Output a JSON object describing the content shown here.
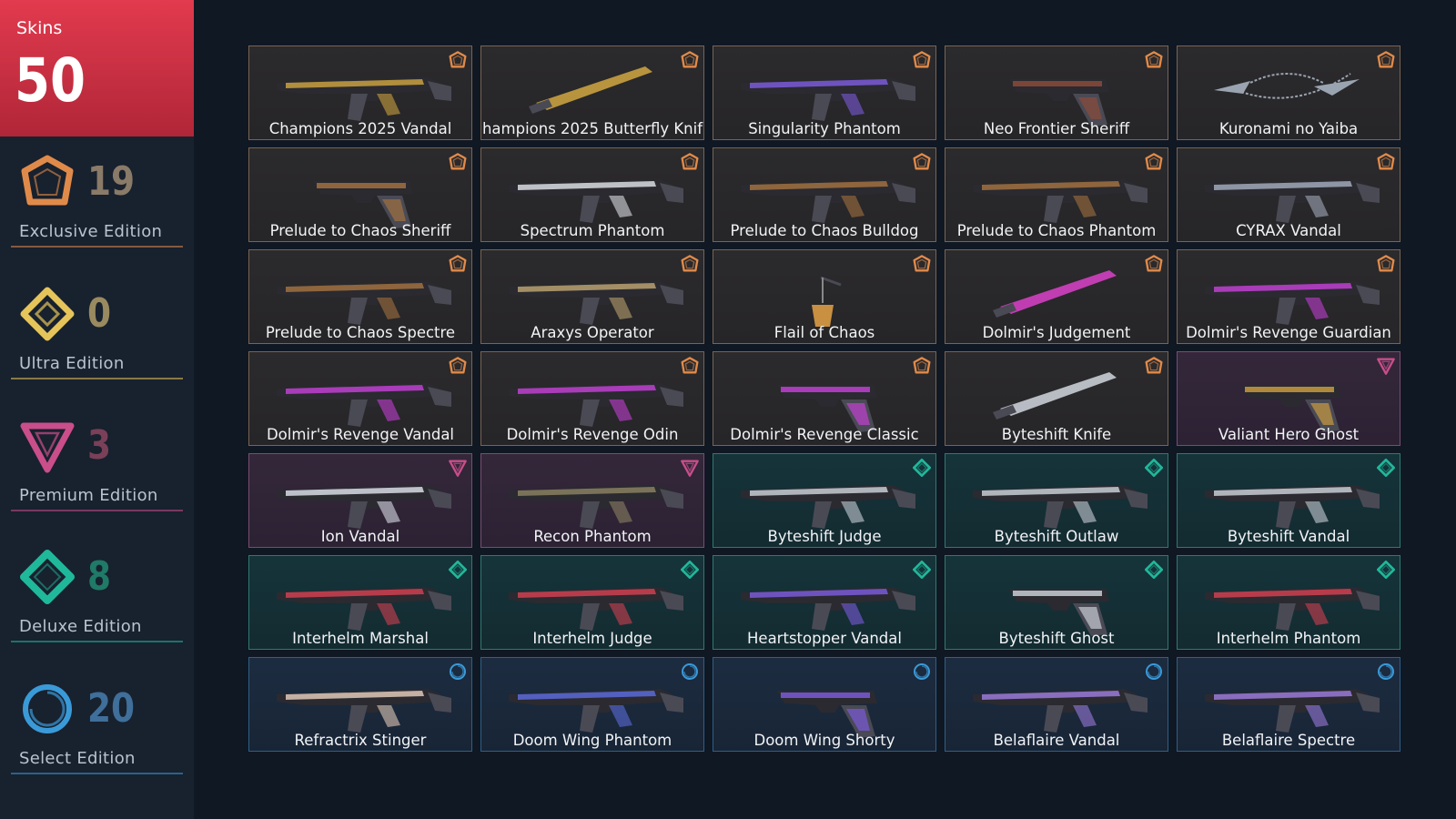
{
  "sidebar": {
    "total_label": "Skins",
    "total_count": "50",
    "tiers": [
      {
        "key": "exclusive",
        "name": "Exclusive Edition",
        "count": "19",
        "color": "#e08a4a",
        "count_color": "#8a7a68",
        "icon": "exclusive-edition-icon"
      },
      {
        "key": "ultra",
        "name": "Ultra Edition",
        "count": "0",
        "color": "#e5c45a",
        "count_color": "#9a8a60",
        "icon": "ultra-edition-icon"
      },
      {
        "key": "premium",
        "name": "Premium Edition",
        "count": "3",
        "color": "#c94e8a",
        "count_color": "#7a4058",
        "icon": "premium-edition-icon"
      },
      {
        "key": "deluxe",
        "name": "Deluxe Edition",
        "count": "8",
        "color": "#1fb89a",
        "count_color": "#1f7a68",
        "icon": "deluxe-edition-icon"
      },
      {
        "key": "select",
        "name": "Select Edition",
        "count": "20",
        "color": "#3a9ad8",
        "count_color": "#3f6f9a",
        "icon": "select-edition-icon"
      }
    ]
  },
  "skins": [
    {
      "name": "Champions 2025 Vandal",
      "tier": "exclusive",
      "accent": "#c8a040"
    },
    {
      "name": "hampions 2025 Butterfly Knif",
      "tier": "exclusive",
      "accent": "#c8a040"
    },
    {
      "name": "Singularity Phantom",
      "tier": "exclusive",
      "accent": "#7a5ad8"
    },
    {
      "name": "Neo Frontier Sheriff",
      "tier": "exclusive",
      "accent": "#8a4a3a"
    },
    {
      "name": "Kuronami no Yaiba",
      "tier": "exclusive",
      "accent": "#9aa4b0"
    },
    {
      "name": "Prelude to Chaos Sheriff",
      "tier": "exclusive",
      "accent": "#a07040"
    },
    {
      "name": "Spectrum Phantom",
      "tier": "exclusive",
      "accent": "#d8dce0"
    },
    {
      "name": "Prelude to Chaos Bulldog",
      "tier": "exclusive",
      "accent": "#a07040"
    },
    {
      "name": "Prelude to Chaos Phantom",
      "tier": "exclusive",
      "accent": "#a07040"
    },
    {
      "name": "CYRAX Vandal",
      "tier": "exclusive",
      "accent": "#a0a8b8"
    },
    {
      "name": "Prelude to Chaos Spectre",
      "tier": "exclusive",
      "accent": "#a07040"
    },
    {
      "name": "Araxys Operator",
      "tier": "exclusive",
      "accent": "#b8a070"
    },
    {
      "name": "Flail of Chaos",
      "tier": "exclusive",
      "accent": "#c89040"
    },
    {
      "name": "Dolmir's Judgement",
      "tier": "exclusive",
      "accent": "#d040c0"
    },
    {
      "name": "Dolmir's Revenge Guardian",
      "tier": "exclusive",
      "accent": "#c040d0"
    },
    {
      "name": "Dolmir's Revenge Vandal",
      "tier": "exclusive",
      "accent": "#c040d0"
    },
    {
      "name": "Dolmir's Revenge Odin",
      "tier": "exclusive",
      "accent": "#c040d0"
    },
    {
      "name": "Dolmir's Revenge Classic",
      "tier": "exclusive",
      "accent": "#c040d0"
    },
    {
      "name": "Byteshift Knife",
      "tier": "exclusive",
      "accent": "#c8ccd4"
    },
    {
      "name": "Valiant Hero Ghost",
      "tier": "premium",
      "accent": "#c89a40"
    },
    {
      "name": "Ion Vandal",
      "tier": "premium",
      "accent": "#d8dce4"
    },
    {
      "name": "Recon Phantom",
      "tier": "premium",
      "accent": "#8a8060"
    },
    {
      "name": "Byteshift Judge",
      "tier": "deluxe",
      "accent": "#c8ccd4"
    },
    {
      "name": "Byteshift Outlaw",
      "tier": "deluxe",
      "accent": "#c8ccd4"
    },
    {
      "name": "Byteshift Vandal",
      "tier": "deluxe",
      "accent": "#c8ccd4"
    },
    {
      "name": "Interhelm Marshal",
      "tier": "deluxe",
      "accent": "#d04050"
    },
    {
      "name": "Interhelm Judge",
      "tier": "deluxe",
      "accent": "#d04050"
    },
    {
      "name": "Heartstopper Vandal",
      "tier": "deluxe",
      "accent": "#7a5ad8"
    },
    {
      "name": "Byteshift Ghost",
      "tier": "deluxe",
      "accent": "#c8ccd4"
    },
    {
      "name": "Interhelm Phantom",
      "tier": "deluxe",
      "accent": "#d04050"
    },
    {
      "name": "Refractrix Stinger",
      "tier": "select",
      "accent": "#e0c8b8"
    },
    {
      "name": "Doom Wing Phantom",
      "tier": "select",
      "accent": "#5a6ad8"
    },
    {
      "name": "Doom Wing Shorty",
      "tier": "select",
      "accent": "#7a5ad8"
    },
    {
      "name": "Belaflaire Vandal",
      "tier": "select",
      "accent": "#9a7ad8"
    },
    {
      "name": "Belaflaire Spectre",
      "tier": "select",
      "accent": "#9a7ad8"
    }
  ]
}
